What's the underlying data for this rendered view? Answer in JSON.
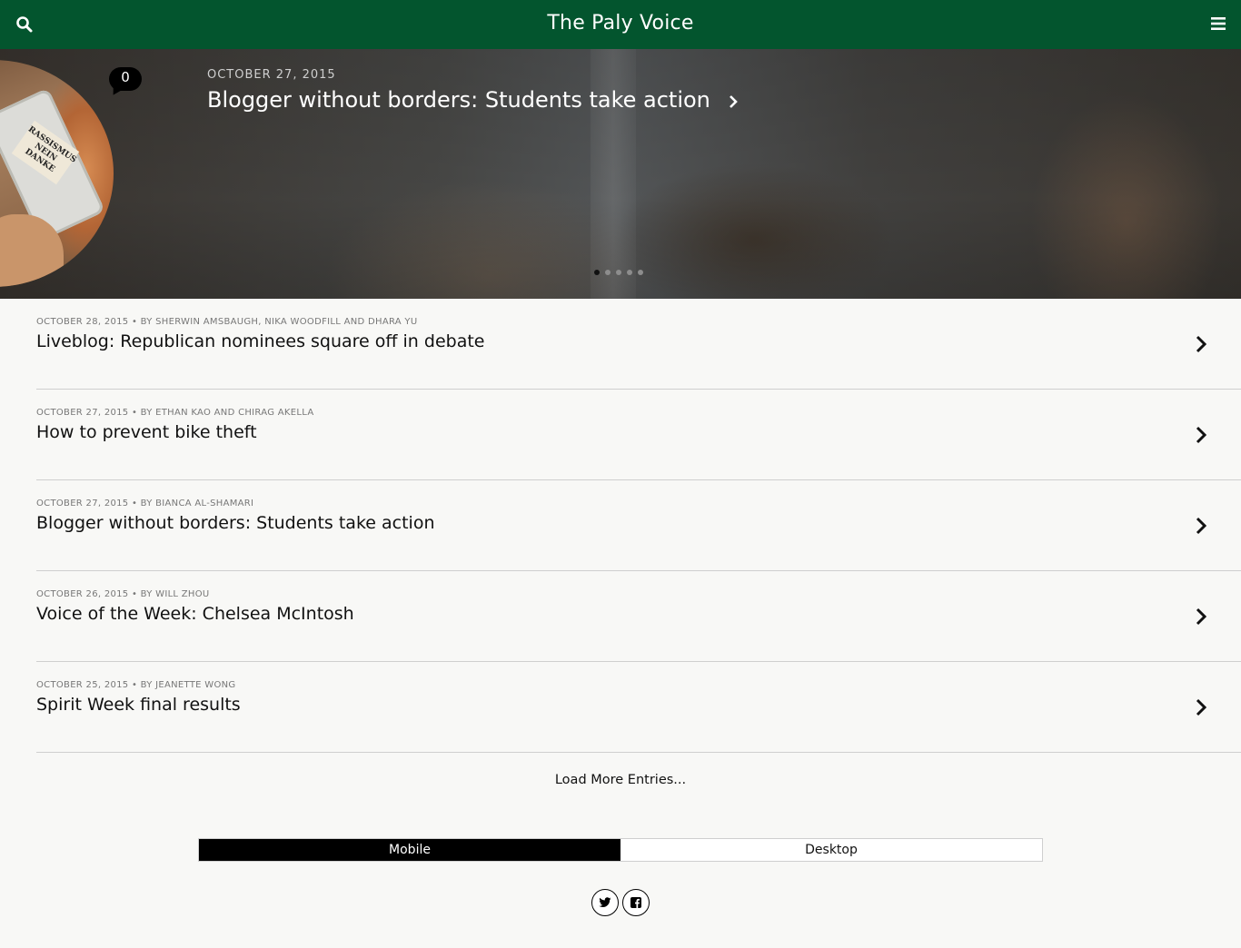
{
  "header": {
    "title": "The Paly Voice",
    "search_icon": "search-icon",
    "menu_icon": "hamburger-menu-icon"
  },
  "featured": {
    "comment_count": "0",
    "date": "OCTOBER 27, 2015",
    "headline": "Blogger without borders: Students take action",
    "thumbnail_text": "RASSISMUS NEIN DANKE",
    "slide_count": 5,
    "active_slide": 1
  },
  "articles": [
    {
      "meta": "OCTOBER 28, 2015 • BY SHERWIN AMSBAUGH, NIKA WOODFILL AND DHARA YU",
      "title": "Liveblog: Republican nominees square off in debate"
    },
    {
      "meta": "OCTOBER 27, 2015 • BY ETHAN KAO AND CHIRAG AKELLA",
      "title": "How to prevent bike theft"
    },
    {
      "meta": "OCTOBER 27, 2015 • BY BIANCA AL-SHAMARI",
      "title": "Blogger without borders: Students take action"
    },
    {
      "meta": "OCTOBER 26, 2015 • BY WILL ZHOU",
      "title": "Voice of the Week: Chelsea McIntosh"
    },
    {
      "meta": "OCTOBER 25, 2015 • BY JEANETTE WONG",
      "title": "Spirit Week final results"
    }
  ],
  "load_more": "Load More Entries...",
  "view_toggle": {
    "mobile": "Mobile",
    "desktop": "Desktop",
    "selected": "Mobile"
  },
  "social": [
    "twitter-icon",
    "facebook-icon"
  ],
  "colors": {
    "header_bg": "#03552e",
    "page_bg": "#f8f8f6"
  }
}
